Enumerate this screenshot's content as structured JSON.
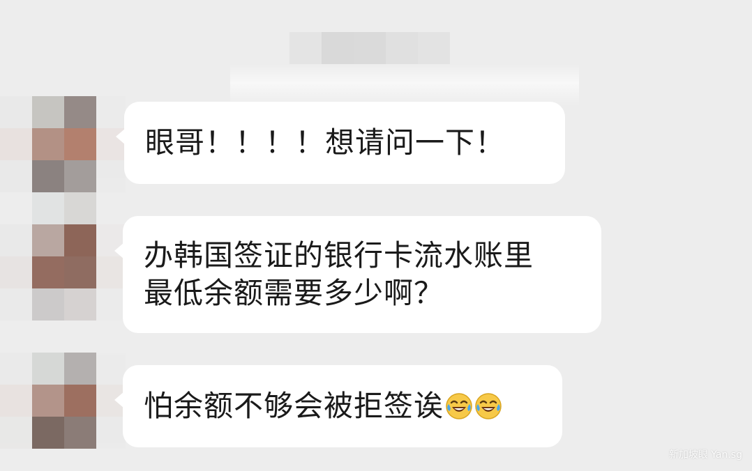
{
  "messages": [
    {
      "lines": [
        "眼哥！！！！想请问一下！"
      ]
    },
    {
      "lines": [
        "办韩国签证的银行卡流水账里",
        "最低余额需要多少啊？"
      ]
    },
    {
      "lines": [
        "怕余额不够会被拒签诶"
      ],
      "trailing_emoji": [
        "laughing-crying-face-icon",
        "laughing-crying-face-icon"
      ]
    }
  ],
  "watermark": "新加坡眼 Yan.sg",
  "colors": {
    "background": "#ededed",
    "bubble": "#ffffff",
    "text": "#1a1a1a"
  }
}
